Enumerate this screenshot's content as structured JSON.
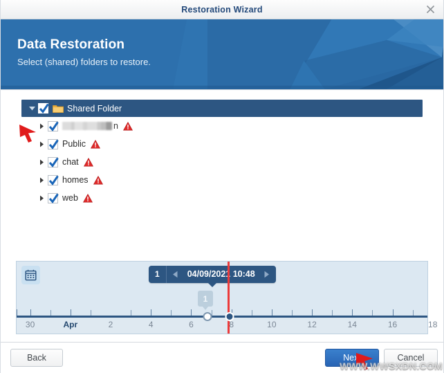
{
  "window": {
    "title": "Restoration Wizard",
    "close_icon": "close-icon"
  },
  "banner": {
    "title": "Data Restoration",
    "subtitle": "Select (shared) folders to restore.",
    "bg_color": "#2d70ad"
  },
  "tree": {
    "root": {
      "label": "Shared Folder",
      "checked": true,
      "expanded": true,
      "selected": true,
      "icon": "folder-icon",
      "caret_icon": "caret-down-icon",
      "selected_bg": "#2d5682"
    },
    "children": [
      {
        "label": "",
        "redacted": true,
        "redacted_tail": "n",
        "checked": true,
        "warning": true,
        "caret_icon": "caret-right-icon"
      },
      {
        "label": "Public",
        "redacted": false,
        "checked": true,
        "warning": true,
        "caret_icon": "caret-right-icon"
      },
      {
        "label": "chat",
        "redacted": false,
        "checked": true,
        "warning": true,
        "caret_icon": "caret-right-icon"
      },
      {
        "label": "homes",
        "redacted": false,
        "checked": true,
        "warning": true,
        "caret_icon": "caret-right-icon"
      },
      {
        "label": "web",
        "redacted": false,
        "checked": true,
        "warning": true,
        "caret_icon": "caret-right-icon"
      }
    ]
  },
  "timeline": {
    "calendar_icon": "calendar-icon",
    "version_count": "1",
    "selected_datetime": "04/09/2021 10:48",
    "prev_icon": "caret-left-icon",
    "next_icon": "caret-right-icon",
    "snapshot_badge": "1",
    "marker_color": "#ec3b3b",
    "axis": {
      "labels": [
        "30",
        "Apr",
        "2",
        "4",
        "6",
        "8",
        "10",
        "12",
        "14",
        "16",
        "18"
      ],
      "month_label": "Apr",
      "selected_day_position_pct": 51.4,
      "snapshot_day_position_pct": 46.5
    }
  },
  "footer": {
    "back_label": "Back",
    "next_label": "Next",
    "cancel_label": "Cancel",
    "primary_color": "#2864b4"
  },
  "overlay": {
    "watermark": "WWW.WWSXDN.COM",
    "cursor_color": "#e01b1b"
  }
}
